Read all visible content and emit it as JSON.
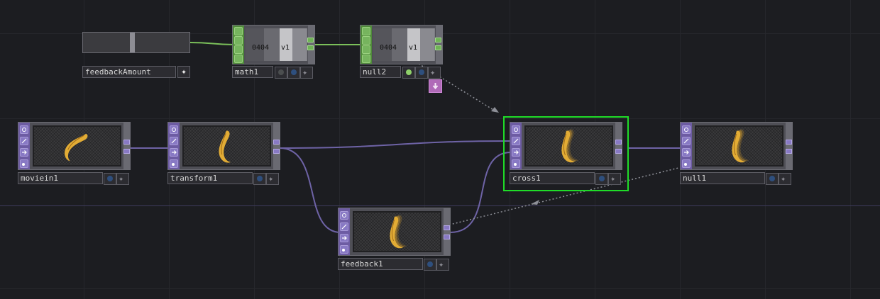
{
  "colors": {
    "background": "#1c1d21",
    "top_family": "#6d5ca3",
    "chop_family": "#4f8a3a",
    "wire_top": "#6e63a6",
    "wire_chop": "#7bc05a",
    "selection": "#1fdc28",
    "export_button": "#b06ab8"
  },
  "slider": {
    "label": "feedbackAmount",
    "add_icon": "plus-icon",
    "value": 0.46
  },
  "chop_nodes": {
    "math1": {
      "name": "math1",
      "values": [
        "0404",
        "v1"
      ]
    },
    "null2": {
      "name": "null2",
      "values": [
        "0404",
        "v1"
      ]
    }
  },
  "top_nodes": {
    "moviein1": {
      "name": "moviein1"
    },
    "transform1": {
      "name": "transform1"
    },
    "cross1": {
      "name": "cross1",
      "selected": true
    },
    "null1": {
      "name": "null1"
    },
    "feedback1": {
      "name": "feedback1"
    }
  },
  "icons": {
    "flag_icons": [
      "bypass-icon",
      "lock-icon",
      "display-icon",
      "viewer-icon"
    ],
    "preview": "banana-icon",
    "pin": "pin-icon",
    "compare": "compare-dot-icon"
  }
}
